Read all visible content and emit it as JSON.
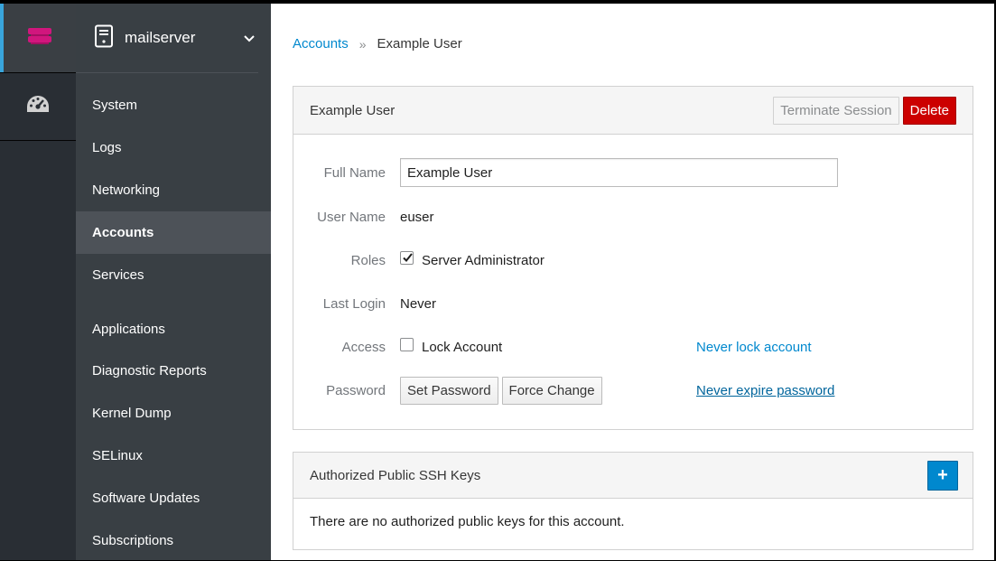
{
  "rail": {
    "host_icon": "server-stack-icon",
    "dashboard_icon": "dashboard-gauge-icon",
    "host_icon_color": "#d1167d"
  },
  "sidebar": {
    "host_name": "mailserver",
    "items": [
      {
        "label": "System",
        "active": false
      },
      {
        "label": "Logs",
        "active": false
      },
      {
        "label": "Networking",
        "active": false
      },
      {
        "label": "Accounts",
        "active": true
      },
      {
        "label": "Services",
        "active": false
      },
      {
        "label": "Applications",
        "active": false
      },
      {
        "label": "Diagnostic Reports",
        "active": false
      },
      {
        "label": "Kernel Dump",
        "active": false
      },
      {
        "label": "SELinux",
        "active": false
      },
      {
        "label": "Software Updates",
        "active": false
      },
      {
        "label": "Subscriptions",
        "active": false
      }
    ]
  },
  "breadcrumb": {
    "parent": "Accounts",
    "separator": "»",
    "current": "Example User"
  },
  "account_panel": {
    "title": "Example User",
    "terminate_label": "Terminate Session",
    "delete_label": "Delete",
    "fields": {
      "full_name_label": "Full Name",
      "full_name_value": "Example User",
      "user_name_label": "User Name",
      "user_name_value": "euser",
      "roles_label": "Roles",
      "roles_value": "Server Administrator",
      "roles_checked": true,
      "last_login_label": "Last Login",
      "last_login_value": "Never",
      "access_label": "Access",
      "lock_account_label": "Lock Account",
      "lock_account_checked": false,
      "never_lock_link": "Never lock account",
      "password_label": "Password",
      "set_password_label": "Set Password",
      "force_change_label": "Force Change",
      "never_expire_link": "Never expire password"
    }
  },
  "ssh_panel": {
    "title": "Authorized Public SSH Keys",
    "add_label": "+",
    "empty_text": "There are no authorized public keys for this account."
  },
  "colors": {
    "accent": "#0088ce",
    "danger": "#cc0000",
    "sidebar_bg": "#393f44",
    "rail_bg": "#292e34"
  }
}
